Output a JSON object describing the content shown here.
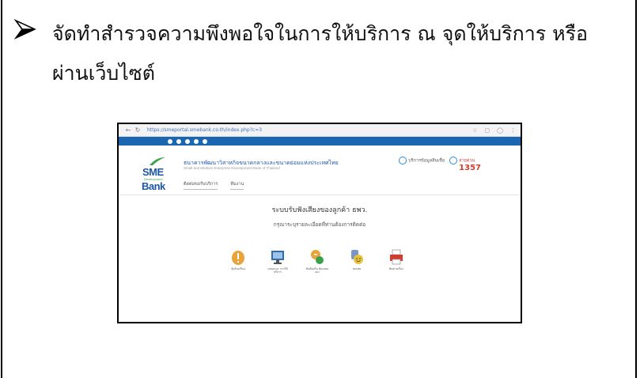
{
  "bullet": {
    "text": "จัดทำสำรวจความพึงพอใจในการให้บริการ ณ  จุดให้บริการ หรือผ่านเว็บไซต์"
  },
  "screenshot": {
    "browser": {
      "url": "https://smeportal.smebank.co.th/index.php?c=3"
    },
    "header": {
      "logo": {
        "sme": "SME",
        "development": "Development",
        "bank": "Bank"
      },
      "bank_name_th": "ธนาคารพัฒนาวิสาหกิจขนาดกลางและขนาดย่อมแห่งประเทศไทย",
      "bank_name_en": "Small and Medium Enterprise Development Bank of Thailand",
      "menu": [
        "ติดต่อขอรับบริการ",
        "ทีมงาน"
      ],
      "contact_label": "บริการข้อมูลสินเชื่อ",
      "hotline_label": "สายด่วน",
      "hotline_number": "1357"
    },
    "main": {
      "title": "ระบบรับฟังเสียงของลูกค้า ธพว.",
      "subtitle": "กรุณาระบุรายละเอียดที่ท่านต้องการติดต่อ",
      "services": [
        {
          "icon": "alert-icon",
          "label": "ข้อร้องเรียน",
          "color": "#e8a33a"
        },
        {
          "icon": "monitor-icon",
          "label": "เสนอแนะ การให้บริการ",
          "color": "#2f6fb0"
        },
        {
          "icon": "idea-icon",
          "label": "ข้อคิดเห็น ข้อเสนอแนะ",
          "color": "#3aa04a"
        },
        {
          "icon": "praise-icon",
          "label": "ชมเชย",
          "color": "#e8c23a"
        },
        {
          "icon": "printer-icon",
          "label": "ติดตามเรื่อง",
          "color": "#d23c2f"
        }
      ]
    }
  }
}
